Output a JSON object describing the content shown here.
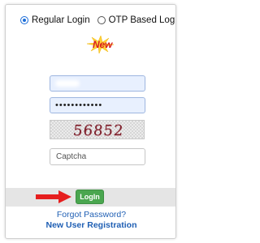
{
  "login_type": {
    "options": [
      {
        "label": "Regular Login",
        "selected": true
      },
      {
        "label": "OTP Based Login",
        "selected": false
      }
    ],
    "new_badge": "New"
  },
  "form": {
    "username_value": "",
    "password_value": "••••••••••••",
    "captcha_image_text": "56852",
    "captcha_placeholder": "Captcha"
  },
  "actions": {
    "login_label": "LogIn",
    "forgot_password": "Forgot Password?",
    "new_user_registration": "New User Registration"
  },
  "colors": {
    "accent_blue": "#1a6cd8",
    "login_green": "#4aa64f",
    "arrow_red": "#e61e1e",
    "new_red": "#d81d1d",
    "link_blue": "#1f5fb4",
    "autofill_bg": "#e8f0fe"
  }
}
